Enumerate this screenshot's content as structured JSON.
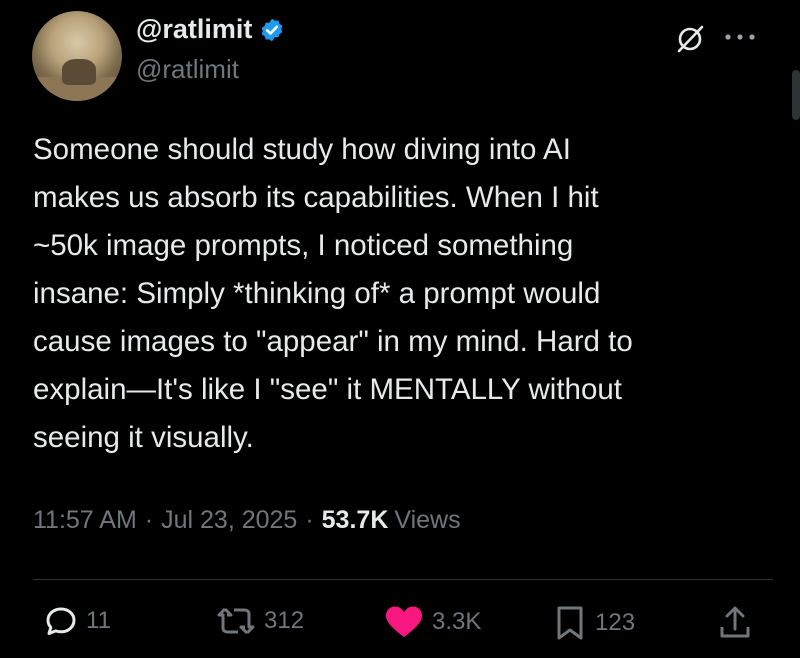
{
  "author": {
    "display_name": "@ratlimit",
    "handle": "@ratlimit",
    "verified": true,
    "verified_color": "#1d9bf0"
  },
  "tweet": {
    "text": "Someone should study how diving into AI\nmakes us absorb its capabilities. When I hit\n~50k image prompts, I noticed something\ninsane: Simply *thinking of* a prompt would\ncause images to \"appear\" in my mind. Hard to\nexplain—It's like I \"see\" it MENTALLY without\nseeing it visually.",
    "time": "11:57 AM",
    "date": "Jul 23, 2025",
    "views_count": "53.7K",
    "views_label": "Views"
  },
  "actions": {
    "replies": "11",
    "reposts": "312",
    "likes": "3.3K",
    "bookmarks": "123"
  },
  "icons": {
    "header": [
      "grok-icon",
      "more-icon"
    ],
    "actions": [
      "reply-icon",
      "repost-icon",
      "like-icon",
      "bookmark-icon",
      "share-icon"
    ]
  },
  "colors": {
    "background": "#000000",
    "text": "#e7e9ea",
    "muted": "#71767b",
    "like": "#f91880"
  }
}
